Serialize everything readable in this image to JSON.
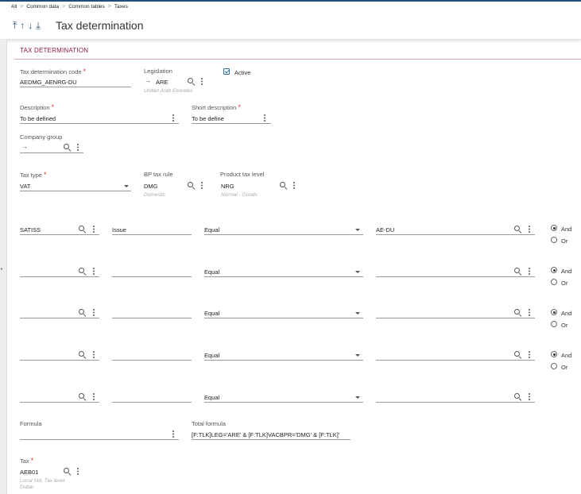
{
  "breadcrumb": [
    "All",
    "Common data",
    "Common tables",
    "Taxes"
  ],
  "header": {
    "title": "Tax determination",
    "nav_icons": [
      "first-icon",
      "prev-icon",
      "next-icon",
      "last-icon"
    ]
  },
  "section": {
    "title": "TAX DETERMINATION"
  },
  "fields": {
    "code": {
      "label": "Tax determination code",
      "value": "AEDMG_AENRG-DU"
    },
    "legislation": {
      "label": "Legislation",
      "value": "ARE",
      "sub": "United Arab Emirates"
    },
    "active": {
      "label": "Active",
      "checked": true
    },
    "description": {
      "label": "Description",
      "value": "To be defined"
    },
    "short_description": {
      "label": "Short description",
      "value": "To be define"
    },
    "company_group": {
      "label": "Company group",
      "value": ""
    },
    "tax_type": {
      "label": "Tax type",
      "value": "VAT"
    },
    "bp_tax_rule": {
      "label": "BP tax rule",
      "value": "DMG",
      "sub": "Domestic"
    },
    "product_tax_level": {
      "label": "Product tax level",
      "value": "NRG",
      "sub": "Normal - Goods"
    },
    "formula": {
      "label": "Formula",
      "value": ""
    },
    "total_formula": {
      "label": "Total formula",
      "value": "[F:TLK]LEG='ARE' & [F:TLK]VACBPR='DMG' & [F:TLK]'"
    },
    "tax": {
      "label": "Tax",
      "value": "AEB01",
      "sub": "Local Std. Tax level-Dubai"
    }
  },
  "conditions": [
    {
      "field": "SATISS",
      "desc": "Issue",
      "operator": "Equal",
      "value": "AE-DU",
      "link": "And"
    },
    {
      "field": "",
      "desc": "",
      "operator": "Equal",
      "value": "",
      "link": "And"
    },
    {
      "field": "",
      "desc": "",
      "operator": "Equal",
      "value": "",
      "link": "And"
    },
    {
      "field": "",
      "desc": "",
      "operator": "Equal",
      "value": "",
      "link": "And"
    },
    {
      "field": "",
      "desc": "",
      "operator": "Equal",
      "value": "",
      "link": ""
    }
  ],
  "link_options": {
    "and": "And",
    "or": "Or"
  },
  "colors": {
    "accent": "#1f4e79",
    "section_title": "#8b1a3a",
    "required": "#e53935"
  }
}
